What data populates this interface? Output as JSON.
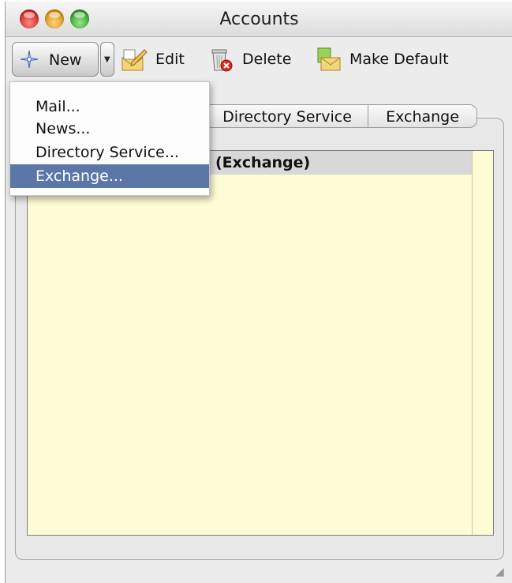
{
  "window": {
    "title": "Accounts"
  },
  "toolbar": {
    "new_label": "New",
    "edit_label": "Edit",
    "delete_label": "Delete",
    "make_default_label": "Make Default"
  },
  "menu": {
    "items": [
      {
        "label": "Mail..."
      },
      {
        "label": "News..."
      },
      {
        "label": "Directory Service..."
      },
      {
        "label": "Exchange...",
        "selected": true
      }
    ]
  },
  "tabs": [
    {
      "label": ""
    },
    {
      "label": ""
    },
    {
      "label": "Directory Service"
    },
    {
      "label": "Exchange"
    }
  ],
  "accounts_list": {
    "rows": [
      {
        "name": "(Exchange)"
      }
    ]
  },
  "colors": {
    "list_background": "#fefcd4",
    "menu_highlight": "#5b77a8",
    "row_background": "#d8d8d8"
  },
  "icons": [
    "new-sparkle-icon",
    "edit-pencil-icon",
    "delete-trash-icon",
    "make-default-envelope-icon",
    "resize-grip-icon"
  ]
}
